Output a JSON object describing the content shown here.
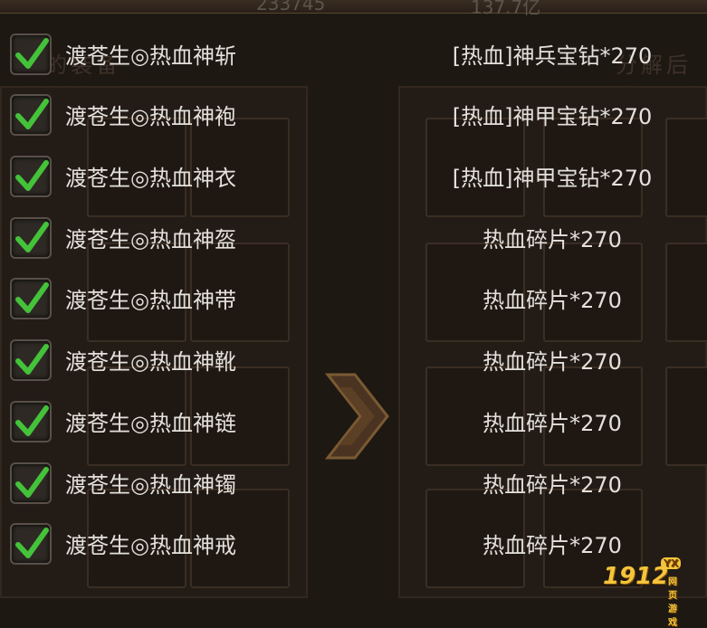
{
  "top_stats": {
    "left": "233745",
    "right": "137.7亿"
  },
  "section_titles": {
    "left": "的装备",
    "right": "分解后获"
  },
  "rows": [
    {
      "checked": true,
      "item": "渡苍生◎热血神斩",
      "result": "[热血]神兵宝钻*270"
    },
    {
      "checked": true,
      "item": "渡苍生◎热血神袍",
      "result": "[热血]神甲宝钻*270"
    },
    {
      "checked": true,
      "item": "渡苍生◎热血神衣",
      "result": "[热血]神甲宝钻*270"
    },
    {
      "checked": true,
      "item": "渡苍生◎热血神盔",
      "result": "热血碎片*270"
    },
    {
      "checked": true,
      "item": "渡苍生◎热血神带",
      "result": "热血碎片*270"
    },
    {
      "checked": true,
      "item": "渡苍生◎热血神靴",
      "result": "热血碎片*270"
    },
    {
      "checked": true,
      "item": "渡苍生◎热血神链",
      "result": "热血碎片*270"
    },
    {
      "checked": true,
      "item": "渡苍生◎热血神镯",
      "result": "热血碎片*270"
    },
    {
      "checked": true,
      "item": "渡苍生◎热血神戒",
      "result": "热血碎片*270"
    }
  ],
  "watermark": {
    "main": "1912",
    "badge": "YX",
    "sub": "网页游戏"
  },
  "colors": {
    "check": "#43c23a",
    "text": "#e4e1dc",
    "accent_gold": "#f4c43a"
  }
}
